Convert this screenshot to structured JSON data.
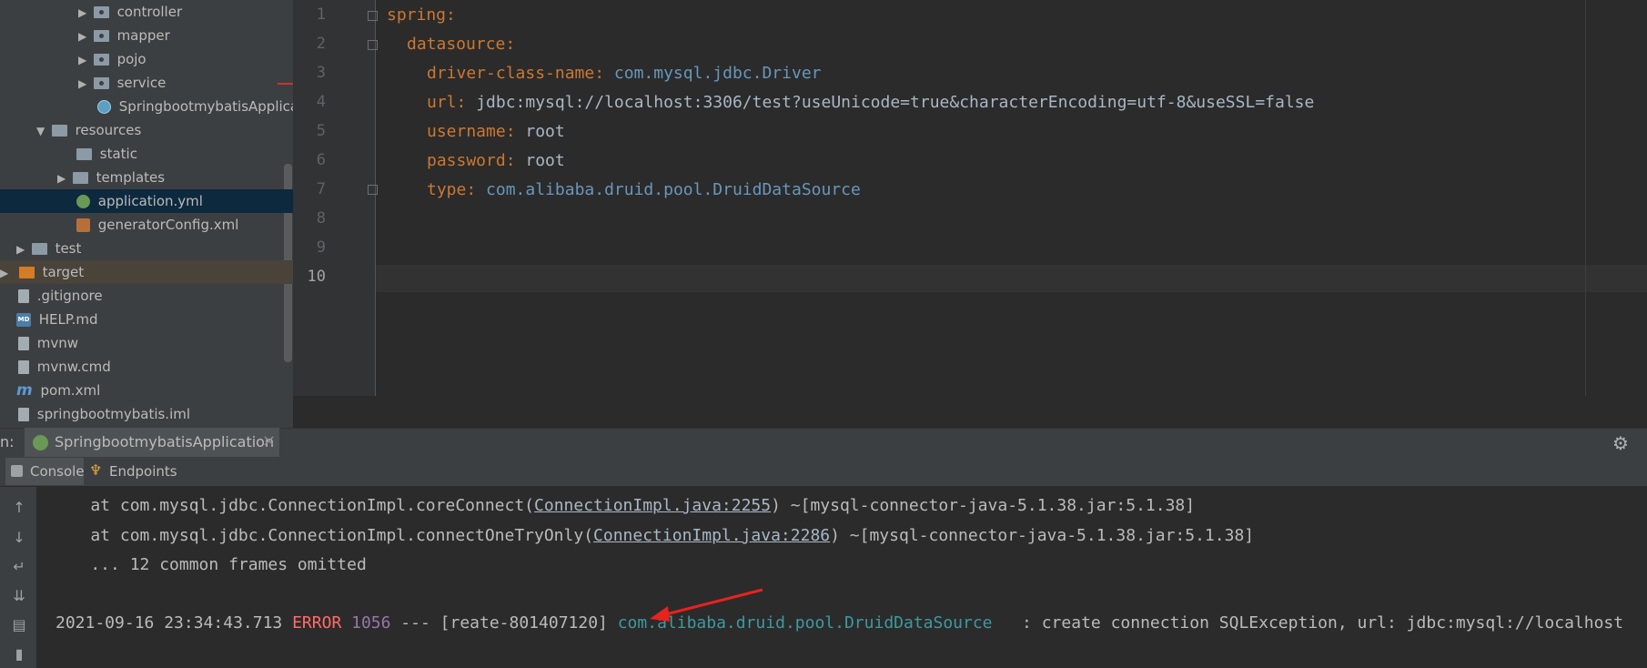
{
  "project_tree": {
    "items": [
      {
        "label": "controller",
        "icon": "package-folder-icon"
      },
      {
        "label": "mapper",
        "icon": "package-folder-icon"
      },
      {
        "label": "pojo",
        "icon": "package-folder-icon"
      },
      {
        "label": "service",
        "icon": "package-folder-icon"
      },
      {
        "label": "SpringbootmybatisApplica",
        "icon": "spring-boot-class-icon"
      },
      {
        "label": "resources",
        "icon": "resources-folder-icon"
      },
      {
        "label": "static",
        "icon": "folder-icon"
      },
      {
        "label": "templates",
        "icon": "folder-icon"
      },
      {
        "label": "application.yml",
        "icon": "spring-yml-icon"
      },
      {
        "label": "generatorConfig.xml",
        "icon": "xml-file-icon"
      },
      {
        "label": "test",
        "icon": "folder-icon"
      },
      {
        "label": "target",
        "icon": "excluded-folder-icon"
      },
      {
        "label": ".gitignore",
        "icon": "text-file-icon"
      },
      {
        "label": "HELP.md",
        "icon": "markdown-file-icon"
      },
      {
        "label": "mvnw",
        "icon": "text-file-icon"
      },
      {
        "label": "mvnw.cmd",
        "icon": "text-file-icon"
      },
      {
        "label": "pom.xml",
        "icon": "maven-file-icon"
      },
      {
        "label": "springbootmybatis.iml",
        "icon": "module-file-icon"
      }
    ],
    "selected": "application.yml"
  },
  "editor": {
    "line_numbers": [
      "1",
      "2",
      "3",
      "4",
      "5",
      "6",
      "7",
      "8",
      "9",
      "10"
    ],
    "current_line": "10",
    "lines": [
      {
        "key": "spring",
        "colon": ":",
        "value": ""
      },
      {
        "key": "datasource",
        "colon": ":",
        "value": ""
      },
      {
        "key": "driver-class-name",
        "colon": ":",
        "value": " com.mysql.jdbc.Driver"
      },
      {
        "key": "url",
        "colon": ":",
        "value": " jdbc:mysql://localhost:3306/test?useUnicode=true&characterEncoding=utf-8&useSSL=false"
      },
      {
        "key": "username",
        "colon": ":",
        "value": " root"
      },
      {
        "key": "password",
        "colon": ":",
        "value": " root"
      },
      {
        "key": "type",
        "colon": ":",
        "value": " com.alibaba.druid.pool.DruidDataSource"
      }
    ]
  },
  "run_panel": {
    "prefix": "n:",
    "tab_label": "SpringbootmybatisApplication",
    "close_glyph": "×",
    "subtabs": [
      {
        "label": "Console"
      },
      {
        "label": "Endpoints"
      }
    ]
  },
  "console": {
    "line1": {
      "pre": "    at com.mysql.jdbc.ConnectionImpl.coreConnect(",
      "link": "ConnectionImpl.java:2255",
      "post": ") ~[mysql-connector-java-5.1.38.jar:5.1.38]"
    },
    "line2": {
      "pre": "    at com.mysql.jdbc.ConnectionImpl.connectOneTryOnly(",
      "link": "ConnectionImpl.java:2286",
      "post": ") ~[mysql-connector-java-5.1.38.jar:5.1.38]"
    },
    "line3": "    ... 12 common frames omitted",
    "line4": {
      "timestamp": "2021-09-16 23:34:43.713 ",
      "level": "ERROR",
      "pid": " 1056",
      "thread": " --- [reate-801407120] ",
      "logger": "com.alibaba.druid.pool.DruidDataSource",
      "message": "   : create connection SQLException, url: jdbc:mysql://localhost"
    }
  },
  "colors": {
    "annotation_arrow": "#e8221e"
  }
}
